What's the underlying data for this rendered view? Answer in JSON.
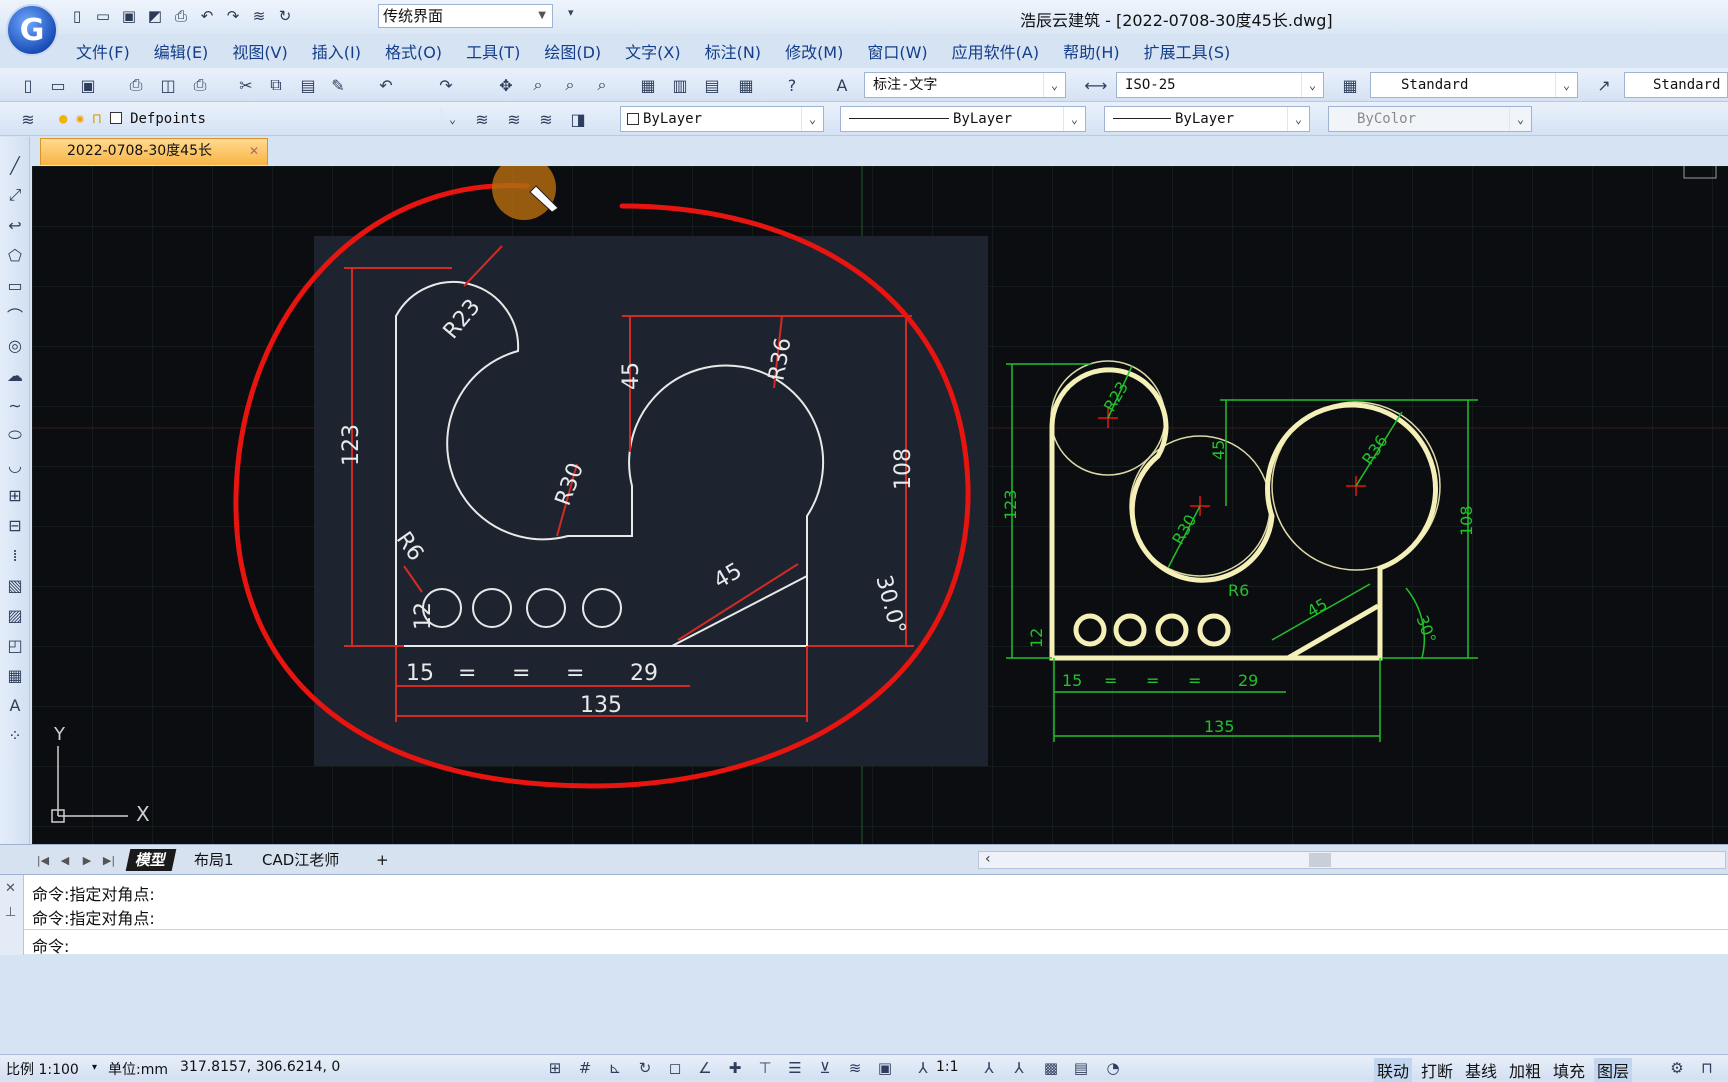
{
  "app": {
    "logo_letter": "G",
    "workspace": "传统界面",
    "title": "浩辰云建筑 - [2022-0708-30度45长.dwg]"
  },
  "menu": [
    "文件(F)",
    "编辑(E)",
    "视图(V)",
    "插入(I)",
    "格式(O)",
    "工具(T)",
    "绘图(D)",
    "文字(X)",
    "标注(N)",
    "修改(M)",
    "窗口(W)",
    "应用软件(A)",
    "帮助(H)",
    "扩展工具(S)"
  ],
  "toolbar": {
    "text_style": "标注-文字",
    "dim_style": "ISO-25",
    "table_style": "Standard",
    "multileader_style": "Standard"
  },
  "layers": {
    "current_layer": "Defpoints",
    "color": "ByLayer",
    "linetype": "ByLayer",
    "lineweight": "ByLayer",
    "plot_style": "ByColor"
  },
  "doc_tab": "2022-0708-30度45长",
  "drawing": {
    "left_dims": [
      "R23",
      "45",
      "R36",
      "123",
      "R30",
      "108",
      "R6",
      "45",
      "30.0°",
      "12",
      "15",
      "=",
      "=",
      "=",
      "29",
      "135"
    ],
    "right_dims": [
      "R23",
      "45",
      "R36",
      "123",
      "R30",
      "108",
      "R6",
      "45",
      "30°",
      "12",
      "15",
      "=",
      "=",
      "=",
      "29",
      "135"
    ],
    "ucs_x": "X",
    "ucs_y": "Y"
  },
  "sheet_tabs": [
    "模型",
    "布局1",
    "CAD江老师",
    "+"
  ],
  "command": {
    "history": [
      "命令:指定对角点:",
      "命令:指定对角点:"
    ],
    "prompt": "命令:"
  },
  "status": {
    "scale": "比例 1:100",
    "unit": "单位:mm",
    "coords": "317.8157, 306.6214, 0",
    "anno_scale": "1:1",
    "switches": [
      "联动",
      "打断",
      "基线",
      "加粗",
      "填充",
      "图层"
    ]
  },
  "colors": {
    "canvas": "#0b0d10",
    "annotation_red": "#e8140f",
    "dim_red": "#d42a24",
    "dim_green": "#22c02a",
    "highlight": "#f4f0b8"
  }
}
